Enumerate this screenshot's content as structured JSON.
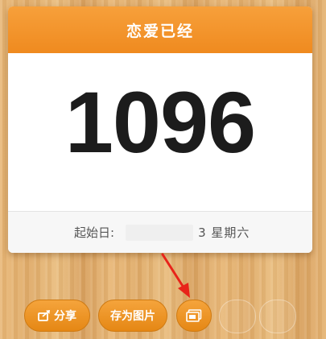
{
  "card": {
    "title": "恋爱已经",
    "day_count": "1096",
    "start_label": "起始日:",
    "start_suffix": "3 星期六"
  },
  "toolbar": {
    "share_label": "分享",
    "save_label": "存为图片",
    "picture_icon": "picture-icon"
  },
  "colors": {
    "header_orange": "#f39328",
    "button_orange": "#ef9526",
    "arrow_red": "#e8231a"
  }
}
